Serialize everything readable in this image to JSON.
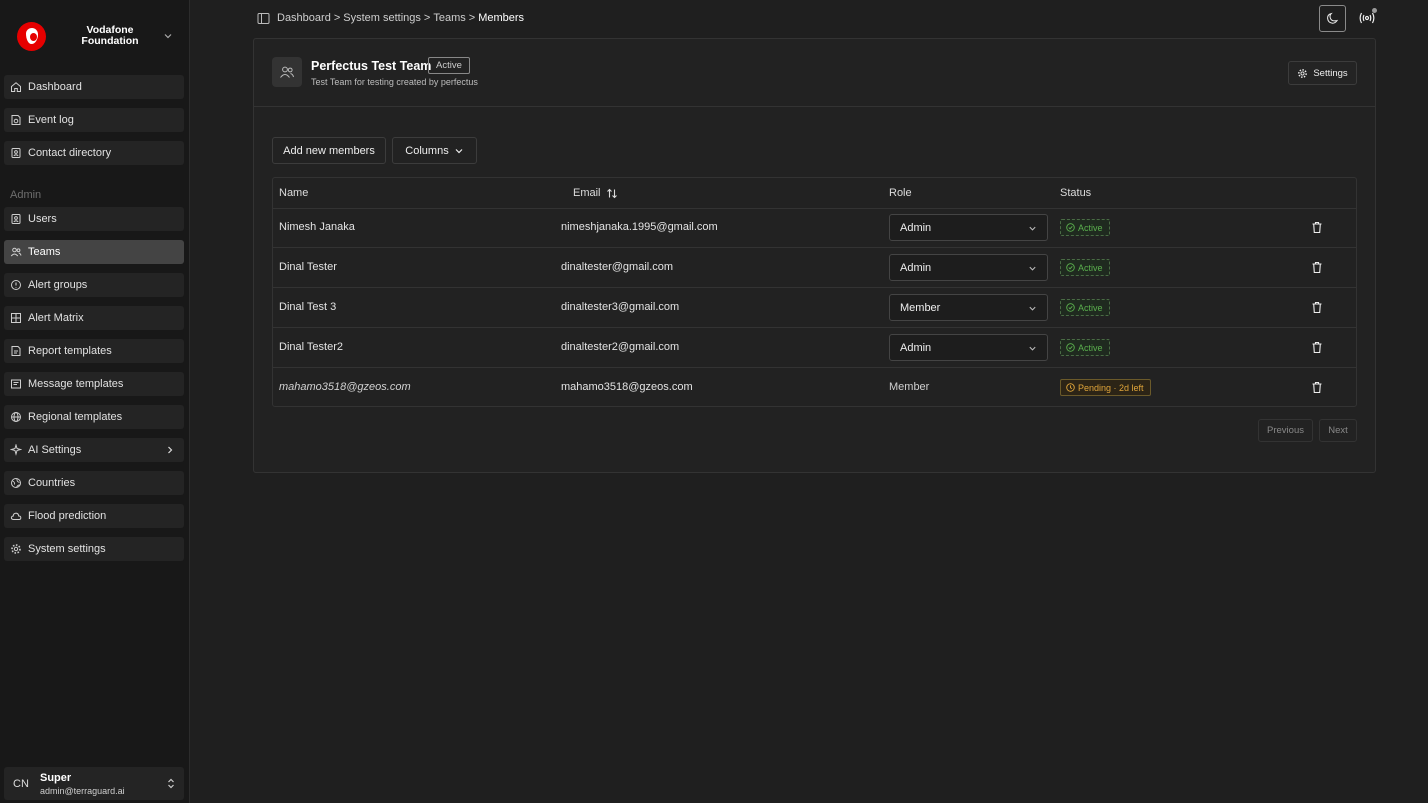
{
  "brand": {
    "name_line1": "Vodafone",
    "name_line2": "Foundation"
  },
  "breadcrumb": {
    "items": [
      "Dashboard",
      "System settings",
      "Teams"
    ],
    "current": "Members",
    "separator": ">"
  },
  "sidebar": {
    "items": [
      {
        "label": "Dashboard",
        "icon": "home-icon"
      },
      {
        "label": "Event log",
        "icon": "event-log-icon"
      },
      {
        "label": "Contact directory",
        "icon": "contact-icon"
      }
    ],
    "section_label": "Admin",
    "admin_items": [
      {
        "label": "Users",
        "icon": "users-icon"
      },
      {
        "label": "Teams",
        "icon": "teams-icon",
        "active": true
      },
      {
        "label": "Alert groups",
        "icon": "alert-icon"
      },
      {
        "label": "Alert Matrix",
        "icon": "grid-icon"
      },
      {
        "label": "Report templates",
        "icon": "report-icon"
      },
      {
        "label": "Message templates",
        "icon": "message-icon"
      },
      {
        "label": "Regional templates",
        "icon": "globe-icon"
      },
      {
        "label": "AI Settings",
        "icon": "sparkles-icon"
      },
      {
        "label": "Countries",
        "icon": "earth-icon"
      },
      {
        "label": "Flood prediction",
        "icon": "cloud-icon"
      },
      {
        "label": "System settings",
        "icon": "gear-icon"
      }
    ]
  },
  "user": {
    "initials": "CN",
    "name": "Super",
    "email": "admin@terraguard.ai"
  },
  "team": {
    "name": "Perfectus Test Team",
    "status": "Active",
    "description": "Test Team for testing created by perfectus",
    "settings_label": "Settings"
  },
  "toolbar": {
    "add_label": "Add new members",
    "columns_label": "Columns"
  },
  "table": {
    "columns": [
      "Name",
      "Email",
      "Role",
      "Status"
    ],
    "rows": [
      {
        "name": "Nimesh Janaka",
        "email": "nimeshjanaka.1995@gmail.com",
        "role": "Admin",
        "status": "Active"
      },
      {
        "name": "Dinal Tester",
        "email": "dinaltester@gmail.com",
        "role": "Admin",
        "status": "Active"
      },
      {
        "name": "Dinal Test 3",
        "email": "dinaltester3@gmail.com",
        "role": "Member",
        "status": "Active"
      },
      {
        "name": "Dinal Tester2",
        "email": "dinaltester2@gmail.com",
        "role": "Admin",
        "status": "Active"
      },
      {
        "name": "mahamo3518@gzeos.com",
        "email": "mahamo3518@gzeos.com",
        "role": "Member",
        "status": "Pending · 2d left"
      }
    ]
  },
  "pagination": {
    "previous_label": "Previous",
    "next_label": "Next"
  },
  "colors": {
    "accent_red": "#e60000",
    "status_active": "#5bb04e",
    "status_pending": "#e0a53a"
  }
}
